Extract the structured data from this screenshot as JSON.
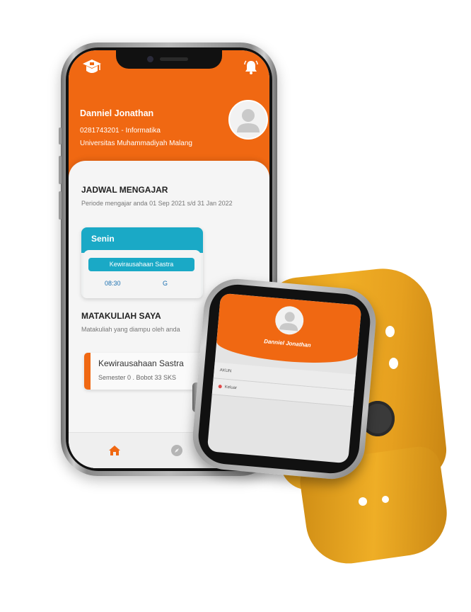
{
  "phone": {
    "profile": {
      "name": "Danniel Jonathan",
      "id_major": "0281743201 - Informatika",
      "university": "Universitas Muhammadiyah Malang"
    },
    "schedule": {
      "title": "JADWAL MENGAJAR",
      "period": "Periode mengajar anda 01 Sep 2021 s/d 31 Jan 2022",
      "day": "Senin",
      "course": "Kewirausahaan Sastra",
      "time": "08:30",
      "room": "G"
    },
    "courses": {
      "title": "MATAKULIAH SAYA",
      "subtitle": "Matakuliah yang diampu oleh anda",
      "items": [
        {
          "name": "Kewirausahaan Sastra",
          "details": "Semester 0  .  Bobot 33 SKS"
        }
      ]
    },
    "nav": {
      "home_icon": "home-icon",
      "explore_icon": "compass-icon"
    }
  },
  "watch": {
    "name": "Danniel Jonathan",
    "menu": [
      {
        "label": "AKUN"
      },
      {
        "label": "Keluar"
      }
    ]
  },
  "colors": {
    "accent": "#f06812",
    "teal": "#1aa9c6",
    "strap": "#e5a21c"
  }
}
